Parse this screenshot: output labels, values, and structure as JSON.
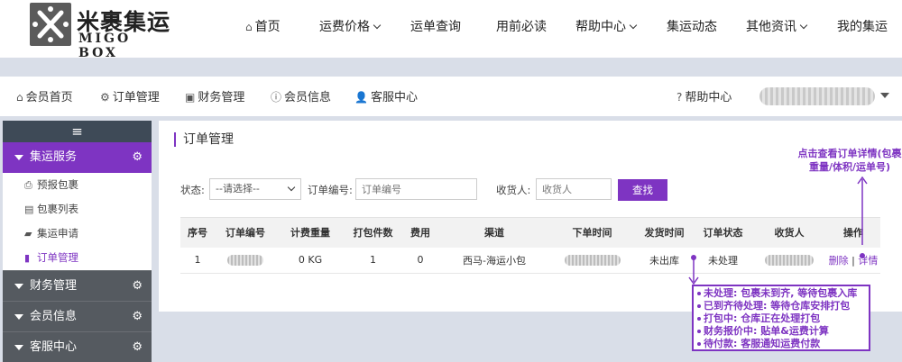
{
  "logo": {
    "cn": "米裹集运",
    "en": "MIGO BOX"
  },
  "top_nav": [
    {
      "label": "首页",
      "icon": "home-icon",
      "dropdown": false
    },
    {
      "label": "运费价格",
      "dropdown": true
    },
    {
      "label": "运单查询",
      "dropdown": false
    },
    {
      "label": "用前必读",
      "dropdown": false
    },
    {
      "label": "帮助中心",
      "dropdown": true
    },
    {
      "label": "集运动态",
      "dropdown": false
    },
    {
      "label": "其他资讯",
      "dropdown": true
    },
    {
      "label": "我的集运",
      "dropdown": false
    }
  ],
  "member_bar": {
    "tabs": [
      {
        "label": "会员首页",
        "icon": "home-icon"
      },
      {
        "label": "订单管理",
        "icon": "gear-icon"
      },
      {
        "label": "财务管理",
        "icon": "money-icon"
      },
      {
        "label": "会员信息",
        "icon": "info-icon"
      },
      {
        "label": "客服中心",
        "icon": "user-icon"
      }
    ],
    "help": {
      "label": "帮助中心",
      "icon": "question-icon"
    }
  },
  "sidebar": {
    "groups": [
      {
        "label": "集运服务",
        "active": true,
        "items": [
          {
            "label": "预报包裹",
            "icon": "print-icon"
          },
          {
            "label": "包裹列表",
            "icon": "list-icon"
          },
          {
            "label": "集运申请",
            "icon": "truck-icon"
          },
          {
            "label": "订单管理",
            "icon": "book-icon",
            "current": true
          }
        ]
      },
      {
        "label": "财务管理"
      },
      {
        "label": "会员信息"
      },
      {
        "label": "客服中心"
      }
    ]
  },
  "main": {
    "title": "订单管理",
    "filter": {
      "status_label": "状态:",
      "status_value": "--请选择--",
      "order_no_label": "订单编号:",
      "order_no_placeholder": "订单编号",
      "receiver_label": "收货人:",
      "receiver_placeholder": "收货人",
      "search_button": "查找"
    },
    "table": {
      "headers": [
        "序号",
        "订单编号",
        "计费重量",
        "打包件数",
        "费用",
        "渠道",
        "下单时间",
        "发货时间",
        "订单状态",
        "收货人",
        "操作"
      ],
      "rows": [
        {
          "index": "1",
          "weight": "0 KG",
          "packages": "1",
          "fee": "0",
          "channel": "西马-海运小包",
          "ship_time": "未出库",
          "status": "未处理",
          "delete": "删除",
          "separator": "|",
          "detail": "详情"
        }
      ]
    }
  },
  "annotations": {
    "detail_hint": "点击查看订单详情(包裹重量/体积/运单号)",
    "status_notes": [
      "未处理: 包裹未到齐, 等待包裹入库",
      "已到齐待处理: 等待仓库安排打包",
      "打包中: 仓库正在处理打包",
      "财务报价中: 贴单&运费计算",
      "待付款: 客服通知运费付款"
    ],
    "accent": "#7e34c2"
  }
}
